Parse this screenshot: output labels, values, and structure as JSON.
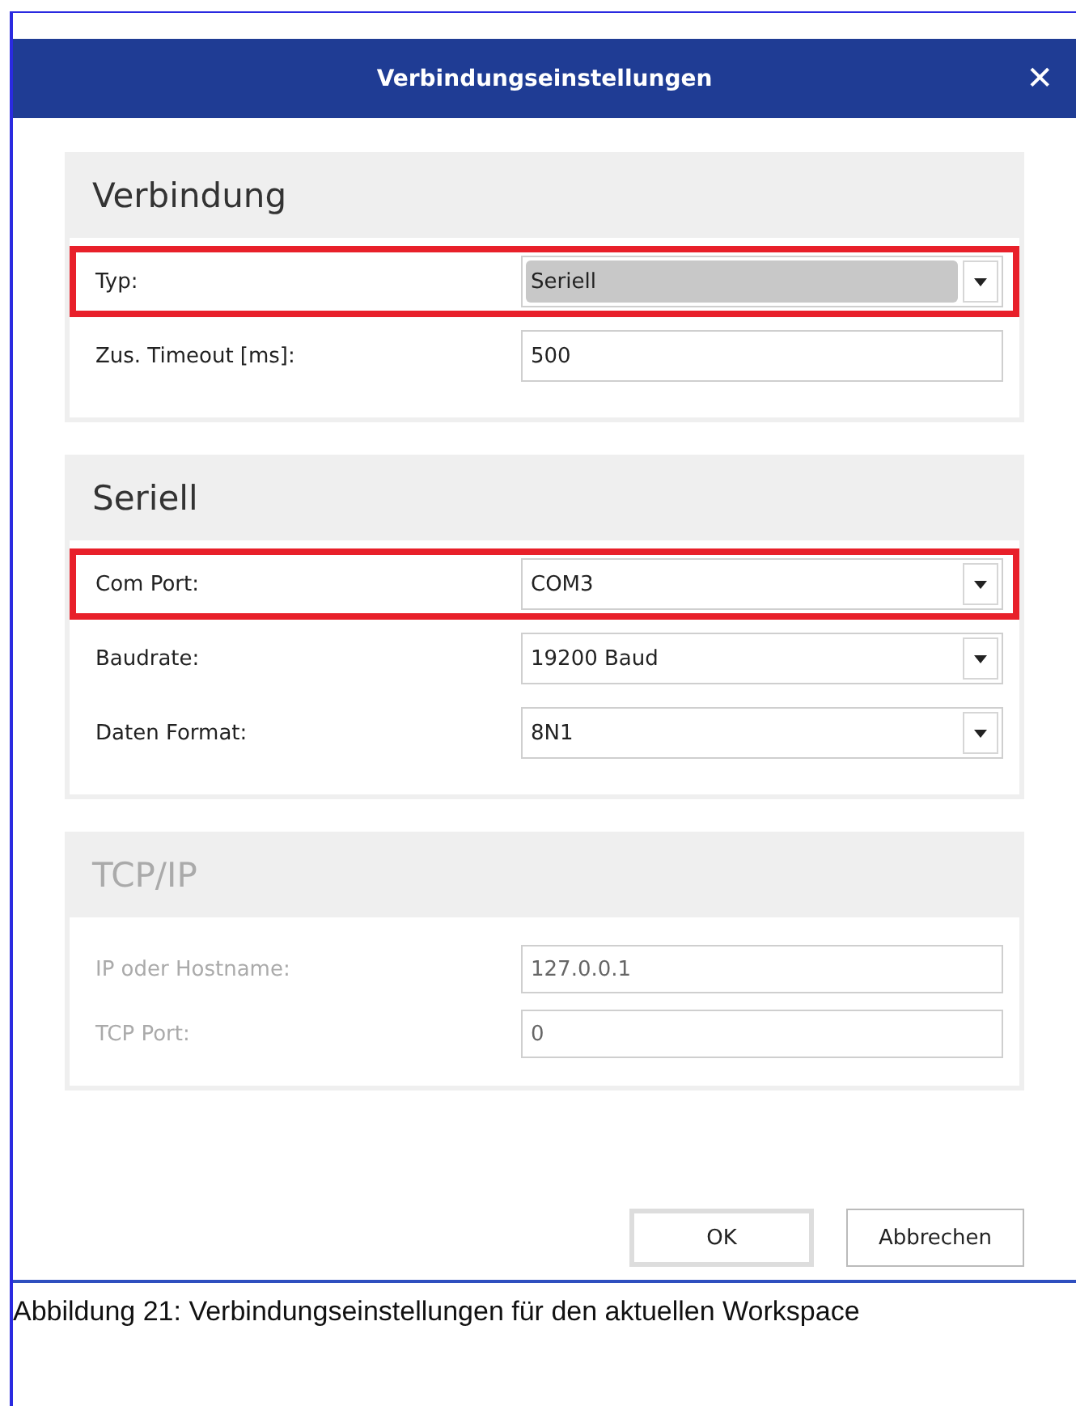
{
  "window": {
    "title": "Verbindungseinstellungen",
    "close": "✕"
  },
  "sections": [
    {
      "title": "Verbindung",
      "disabled": false,
      "fields": [
        {
          "label": "Typ:",
          "kind": "dropdown",
          "value": "Seriell",
          "highlighted": true,
          "focused": true
        },
        {
          "label": "Zus. Timeout [ms]:",
          "kind": "text",
          "value": "500",
          "highlighted": false,
          "focused": false
        }
      ]
    },
    {
      "title": "Seriell",
      "disabled": false,
      "fields": [
        {
          "label": "Com Port:",
          "kind": "dropdown",
          "value": "COM3",
          "highlighted": true,
          "focused": false
        },
        {
          "label": "Baudrate:",
          "kind": "dropdown",
          "value": "19200 Baud",
          "highlighted": false,
          "focused": false
        },
        {
          "label": "Daten Format:",
          "kind": "dropdown",
          "value": "8N1",
          "highlighted": false,
          "focused": false
        }
      ]
    },
    {
      "title": "TCP/IP",
      "disabled": true,
      "fields": [
        {
          "label": "IP oder Hostname:",
          "kind": "text",
          "value": "127.0.0.1",
          "highlighted": false,
          "focused": false
        },
        {
          "label": "TCP Port:",
          "kind": "text",
          "value": "0",
          "highlighted": false,
          "focused": false
        }
      ]
    }
  ],
  "buttons": [
    {
      "label": "OK",
      "default": true
    },
    {
      "label": "Abbrechen",
      "default": false
    }
  ],
  "caption": "Abbildung 21: Verbindungseinstellungen für den aktuellen Workspace"
}
